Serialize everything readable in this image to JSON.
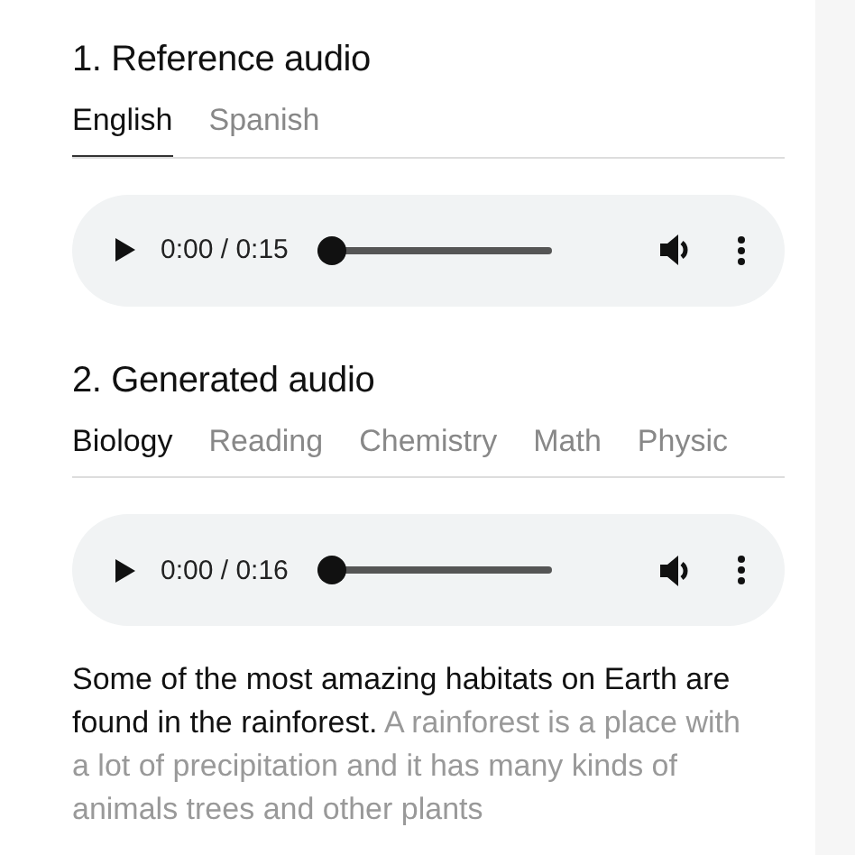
{
  "sections": [
    {
      "title": "1. Reference audio",
      "tabs": [
        {
          "label": "English",
          "selected": true
        },
        {
          "label": "Spanish",
          "selected": false
        }
      ],
      "player": {
        "time": "0:00 / 0:15",
        "level": 0
      }
    },
    {
      "title": "2. Generated audio",
      "tabs": [
        {
          "label": "Biology",
          "selected": true
        },
        {
          "label": "Reading",
          "selected": false
        },
        {
          "label": "Chemistry",
          "selected": false
        },
        {
          "label": "Math",
          "selected": false
        },
        {
          "label": "Physic",
          "selected": false
        }
      ],
      "player": {
        "time": "0:00 / 0:16",
        "level": 0
      },
      "transcript": {
        "spoken": "Some of the most amazing habitats on Earth are found in the rainforest.",
        "remaining": "A rainforest is a place with a lot of precipitation and it has many kinds of animals trees and other plants"
      }
    }
  ]
}
